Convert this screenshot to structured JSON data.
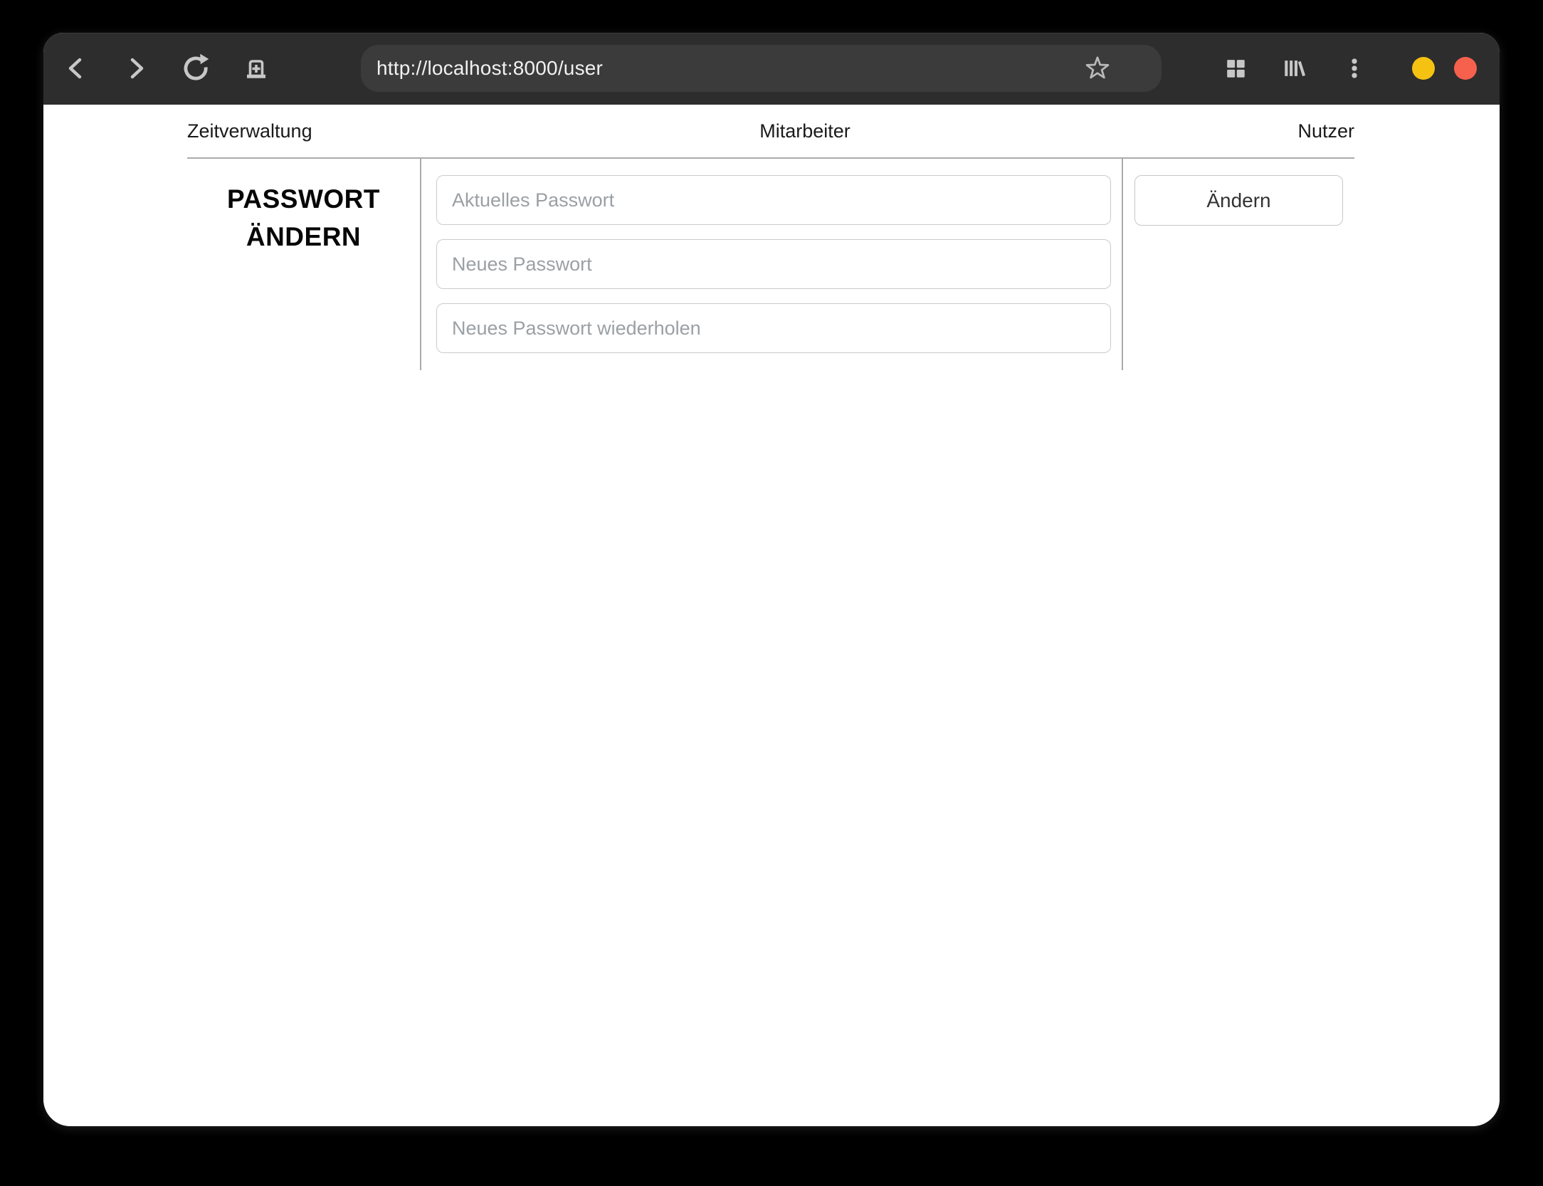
{
  "browser": {
    "url": "http://localhost:8000/user",
    "toolbar": {
      "back_icon": "chevron-left",
      "forward_icon": "chevron-right",
      "reload_icon": "reload-arrow",
      "new_tab_icon": "new-tab",
      "bookmark_icon": "star-outline",
      "apps_icon": "app-grid",
      "library_icon": "library-books",
      "menu_icon": "kebab-menu"
    }
  },
  "window_controls": {
    "minimize_color": "#f5c211",
    "close_color": "#f6614e"
  },
  "nav": {
    "items": [
      {
        "label": "Zeitverwaltung"
      },
      {
        "label": "Mitarbeiter"
      },
      {
        "label": "Nutzer"
      }
    ]
  },
  "password_form": {
    "heading": "PASSWORT ÄNDERN",
    "fields": [
      {
        "placeholder": "Aktuelles Passwort"
      },
      {
        "placeholder": "Neues Passwort"
      },
      {
        "placeholder": "Neues Passwort wiederholen"
      }
    ],
    "submit_label": "Ändern"
  },
  "colors": {
    "titlebar_bg": "#2d2d2d",
    "urlbar_bg": "#3b3b3b",
    "page_bg": "#ffffff",
    "table_border": "#ababab",
    "input_border": "#cbcbcb",
    "placeholder_text": "#9ba0a4"
  }
}
